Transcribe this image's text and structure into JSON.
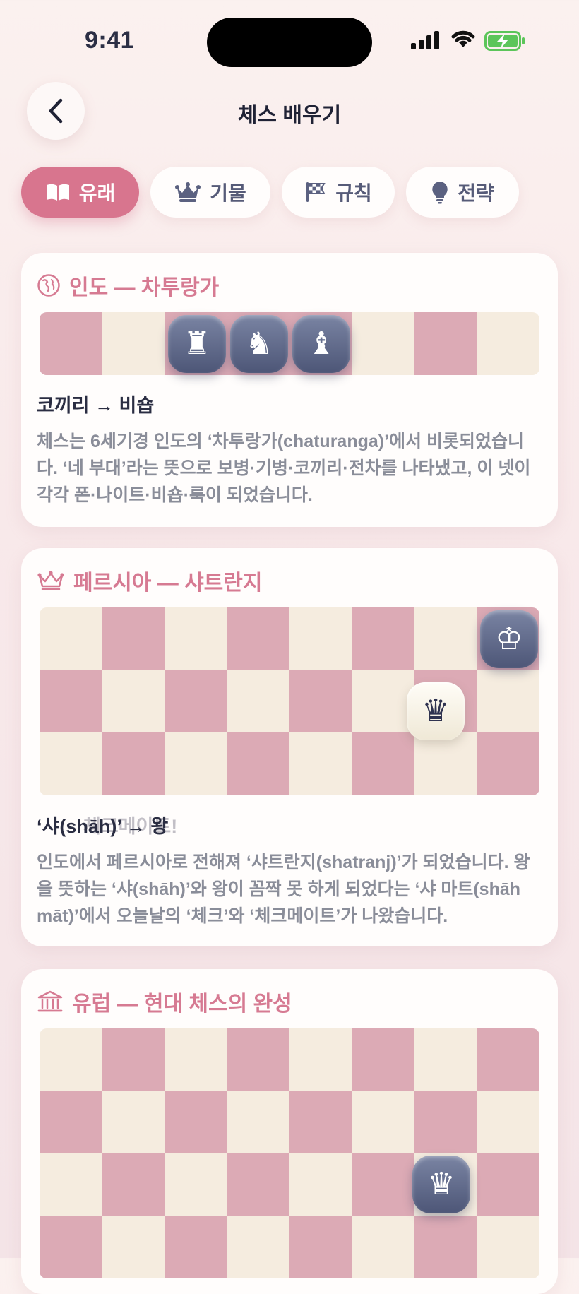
{
  "status": {
    "time": "9:41"
  },
  "header": {
    "title": "체스 배우기"
  },
  "tabs": [
    {
      "label": "유래",
      "icon": "book-icon",
      "active": true
    },
    {
      "label": "기물",
      "icon": "crown-icon",
      "active": false
    },
    {
      "label": "규칙",
      "icon": "flag-icon",
      "active": false
    },
    {
      "label": "전략",
      "icon": "bulb-icon",
      "active": false
    }
  ],
  "cards": [
    {
      "title": "인도 — 차투랑가",
      "icon": "globe-icon",
      "board_pieces": [
        "♜",
        "♞",
        "♝"
      ],
      "subtitle": "코끼리 → 비숍",
      "desc": "체스는 6세기경 인도의 ‘차투랑가(chaturanga)’에서 비롯되었습니다. ‘네 부대’라는 뜻으로 보병·기병·코끼리·전차를 나타냈고, 이 넷이 각각 폰·나이트·비숍·룩이 되었습니다."
    },
    {
      "title": "페르시아 — 샤트란지",
      "icon": "crown-icon",
      "board_pieces": [
        "♔",
        "♛"
      ],
      "subtitle": "‘샤(shāh)’ → 왕",
      "ghost": "체크메이트!",
      "desc": "인도에서 페르시아로 전해져 ‘샤트란지(shatranj)’가 되었습니다. 왕을 뜻하는 ‘샤(shāh)’와 왕이 꼼짝 못 하게 되었다는 ‘샤 마트(shāh māt)’에서 오늘날의 ‘체크’와 ‘체크메이트’가 나왔습니다."
    },
    {
      "title": "유럽 — 현대 체스의 완성",
      "icon": "museum-icon",
      "board_pieces": [
        "♛"
      ]
    }
  ]
}
